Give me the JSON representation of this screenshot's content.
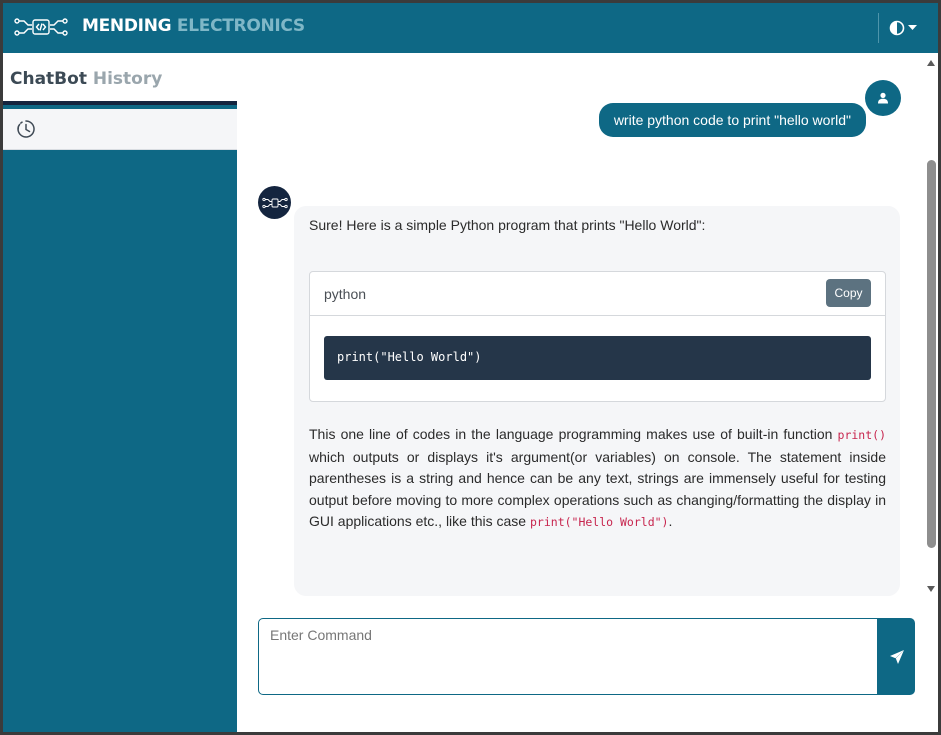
{
  "header": {
    "brand_part1": "MENDING",
    "brand_part2": "ELECTRONICS",
    "logo_icon": "circuit-code-icon",
    "theme_icon": "half-circle-contrast-icon",
    "dropdown_icon": "caret-down-icon"
  },
  "sidebar": {
    "title_part1": "ChatBot",
    "title_part2": "History",
    "history_icon": "clock-history-icon"
  },
  "chat": {
    "user_message": "write python code to print \"hello world\"",
    "bot_intro": "Sure! Here is a simple Python program that prints \"Hello World\":",
    "code_language": "python",
    "copy_label": "Copy",
    "code": "print(\"Hello World\")",
    "explain_part1": "This one line of codes in the language programming makes use of built-in function ",
    "explain_code1": "print()",
    "explain_part2": " which outputs or displays it's argument(or variables) on console. The statement inside parentheses is a string and hence can be any text, strings are immensely useful for testing output before moving to more complex operations such as changing/formatting the display in GUI applications etc., like this case ",
    "explain_code2": "print(\"Hello World\")",
    "explain_part3": "."
  },
  "input": {
    "placeholder": "Enter Command",
    "send_icon": "paper-plane-icon"
  },
  "colors": {
    "primary": "#0e6885",
    "navy": "#14253f",
    "code_bg": "#253649",
    "bubble_bg": "#f5f6f8"
  }
}
